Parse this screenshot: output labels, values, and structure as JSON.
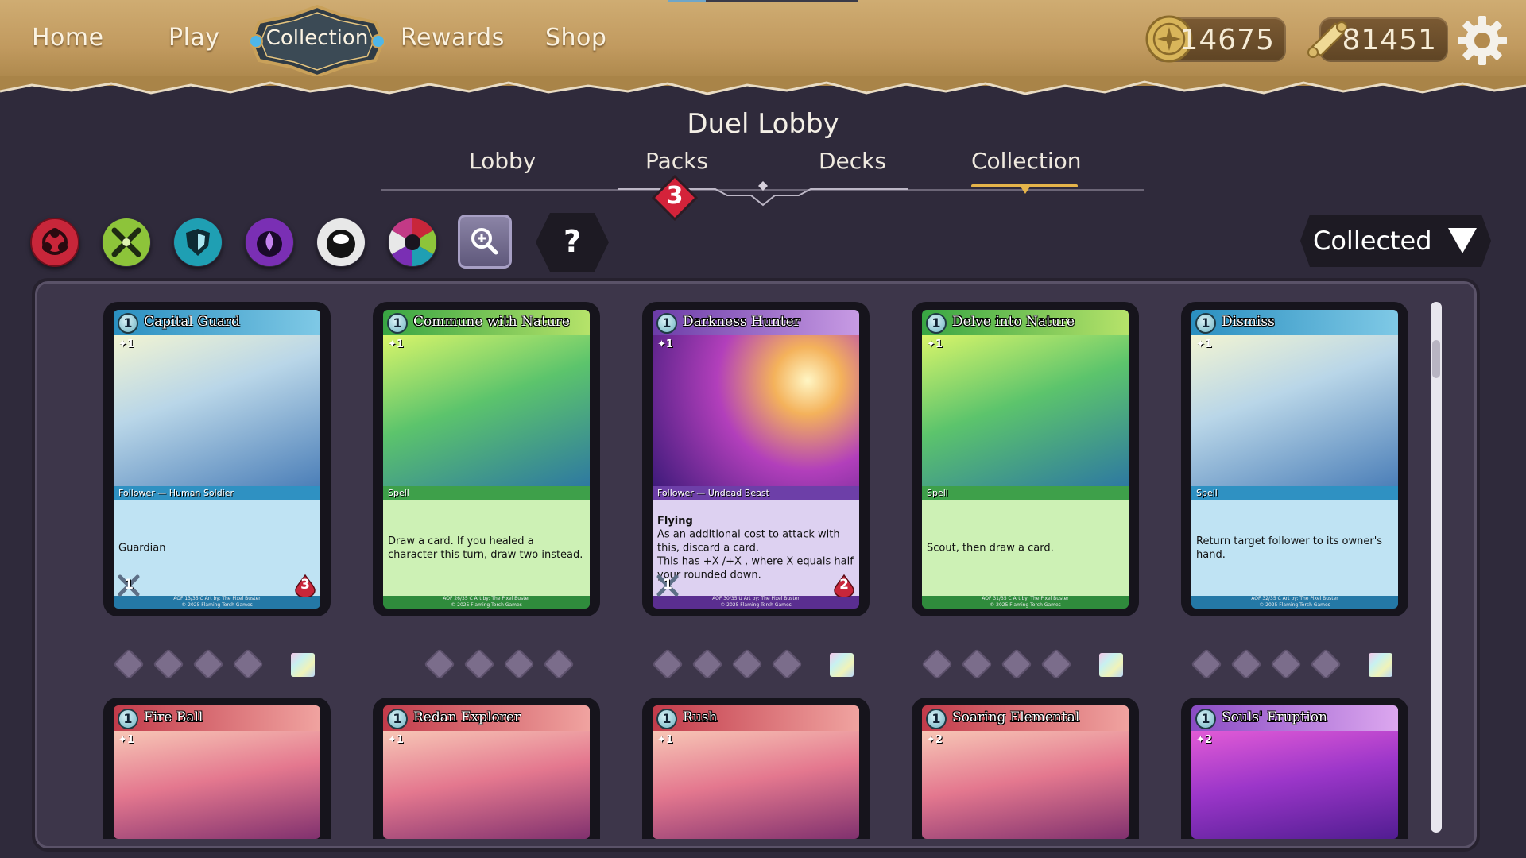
{
  "nav": {
    "items": [
      "Home",
      "Play",
      "Collection",
      "Rewards",
      "Shop"
    ],
    "active": "Collection"
  },
  "currency": {
    "gold": "14675",
    "scrolls": "81451"
  },
  "lobby": {
    "title": "Duel Lobby",
    "tabs": [
      "Lobby",
      "Packs",
      "Decks",
      "Collection"
    ],
    "active_tab": "Collection",
    "packs_badge": "3"
  },
  "filters": {
    "factions": [
      {
        "name": "red-faction",
        "color": "#c8263a"
      },
      {
        "name": "green-faction",
        "color": "#8dc43a"
      },
      {
        "name": "blue-faction",
        "color": "#1f9fb3"
      },
      {
        "name": "purple-faction",
        "color": "#7a2fb4"
      },
      {
        "name": "white-faction",
        "color": "#e8e8e8"
      },
      {
        "name": "multi-faction",
        "color": "#c33a86"
      }
    ],
    "help_label": "?",
    "dropdown_label": "Collected"
  },
  "cards": [
    {
      "name": "Capital Guard",
      "cost": "1",
      "req": "1",
      "theme": "blue",
      "type": "Follower — Human Soldier",
      "text": [
        "Guardian"
      ],
      "attack": "1",
      "health": "3",
      "footer": [
        "AOF 13/35 C Art by: The Pixel Buster",
        "© 2025 Flaming Torch Games"
      ]
    },
    {
      "name": "Commune with Nature",
      "cost": "1",
      "req": "1",
      "theme": "green",
      "type": "Spell",
      "text": [
        "Draw a card. If you healed a character this turn, draw two instead."
      ],
      "footer": [
        "AOF 26/35 C Art by: The Pixel Buster",
        "© 2025 Flaming Torch Games"
      ]
    },
    {
      "name": "Darkness Hunter",
      "cost": "1",
      "req": "1",
      "theme": "purple",
      "type": "Follower — Undead Beast",
      "text": [
        "Flying",
        "As an additional cost to attack with this, discard a card.",
        "This has +X /+X , where X equals half your  rounded down."
      ],
      "attack": "1",
      "health": "2",
      "footer": [
        "AOF 30/35 U Art by: The Pixel Buster",
        "© 2025 Flaming Torch Games"
      ]
    },
    {
      "name": "Delve into Nature",
      "cost": "1",
      "req": "1",
      "theme": "green",
      "type": "Spell",
      "text": [
        "Scout, then draw a card."
      ],
      "footer": [
        "AOF 31/35 C Art by: The Pixel Buster",
        "© 2025 Flaming Torch Games"
      ]
    },
    {
      "name": "Dismiss",
      "cost": "1",
      "req": "1",
      "theme": "blue",
      "type": "Spell",
      "text": [
        "Return target follower to its owner's hand."
      ],
      "footer": [
        "AOF 32/35 C Art by: The Pixel Buster",
        "© 2025 Flaming Torch Games"
      ]
    },
    {
      "name": "Fire Ball",
      "cost": "1",
      "req": "1",
      "theme": "red"
    },
    {
      "name": "Redan Explorer",
      "cost": "1",
      "req": "1",
      "theme": "red"
    },
    {
      "name": "Rush",
      "cost": "1",
      "req": "1",
      "theme": "red"
    },
    {
      "name": "Soaring Elemental",
      "cost": "1",
      "req": "2",
      "theme": "red"
    },
    {
      "name": "Souls' Eruption",
      "cost": "1",
      "req": "2",
      "theme": "violet"
    }
  ],
  "copies": [
    {
      "owned": 4,
      "foil": true
    },
    {
      "owned": 4,
      "foil": false
    },
    {
      "owned": 4,
      "foil": true
    },
    {
      "owned": 4,
      "foil": true
    },
    {
      "owned": 4,
      "foil": true
    }
  ]
}
